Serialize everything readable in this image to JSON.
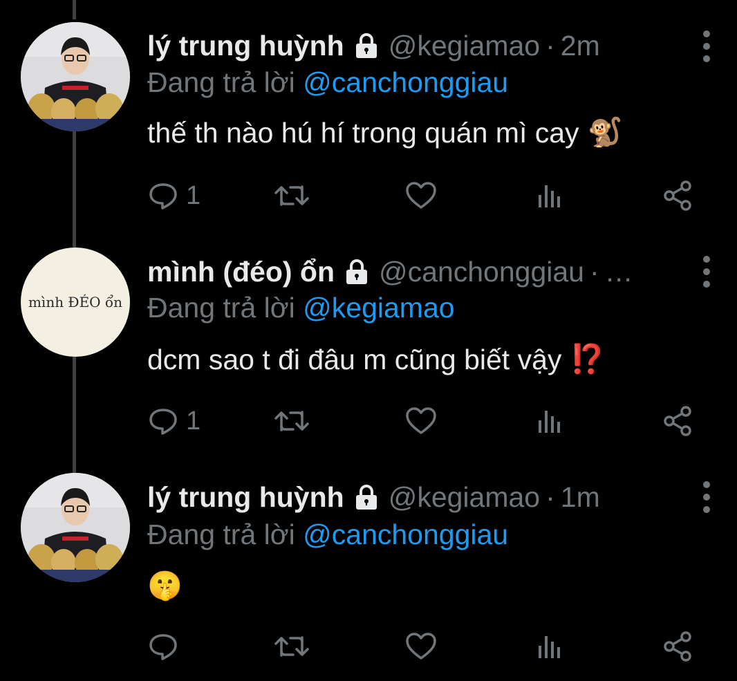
{
  "tweets": [
    {
      "name": "lý trung huỳnh",
      "handle": "@kegiamao",
      "separator": "·",
      "time": "2m",
      "reply_label": "Đang trả lời",
      "reply_to": "@canchonggiau",
      "text": "thế th nào hú hí trong quán mì cay",
      "emoji": "🐒",
      "reply_count": "1",
      "avatar_type": "photo"
    },
    {
      "name": "mình (đéo) ổn",
      "handle": "@canchonggiau",
      "separator": "·",
      "time": "…",
      "reply_label": "Đang trả lời",
      "reply_to": "@kegiamao",
      "text": "dcm sao t đi đâu m cũng biết vậy",
      "emoji": "⁉️",
      "reply_count": "1",
      "avatar_type": "text",
      "avatar_text": "mình ĐÉO ổn"
    },
    {
      "name": "lý trung huỳnh",
      "handle": "@kegiamao",
      "separator": "·",
      "time": "1m",
      "reply_label": "Đang trả lời",
      "reply_to": "@canchonggiau",
      "text": "",
      "emoji": "🤫",
      "reply_count": "",
      "avatar_type": "photo"
    }
  ],
  "icons": {
    "lock": "lock-icon",
    "reply": "reply-icon",
    "retweet": "retweet-icon",
    "like": "heart-icon",
    "analytics": "analytics-icon",
    "share": "share-icon",
    "more": "more-vertical-icon"
  },
  "colors": {
    "background": "#000000",
    "text": "#e7e9ea",
    "muted": "#71767b",
    "link": "#1d9bf0",
    "thread_line": "#3e4144"
  }
}
